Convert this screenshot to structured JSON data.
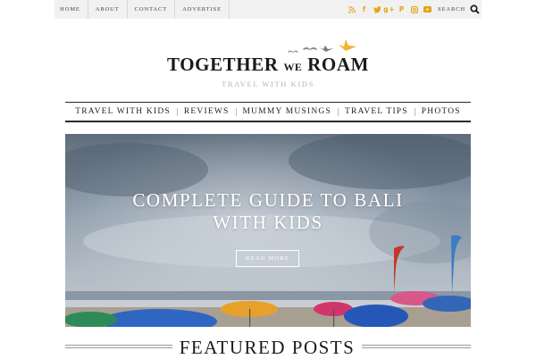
{
  "top_nav": {
    "items": [
      "HOME",
      "ABOUT",
      "CONTACT",
      "ADVERTISE"
    ]
  },
  "social": {
    "icons": [
      "rss-icon",
      "facebook-icon",
      "twitter-icon",
      "google-plus-icon",
      "pinterest-icon",
      "instagram-icon",
      "youtube-icon"
    ],
    "accent_color": "#e3a416"
  },
  "search": {
    "label": "SEARCH"
  },
  "logo": {
    "part1": "TOGETHER",
    "part2": "WE",
    "part3": "ROAM",
    "tagline": "TRAVEL WITH KIDS",
    "bird_color": "#f0b429"
  },
  "main_nav": {
    "items": [
      "TRAVEL WITH KIDS",
      "REVIEWS",
      "MUMMY MUSINGS",
      "TRAVEL TIPS",
      "PHOTOS"
    ]
  },
  "hero": {
    "title_line1": "COMPLETE GUIDE TO BALI",
    "title_line2": "WITH KIDS",
    "button_label": "READ MORE"
  },
  "featured": {
    "title": "FEATURED POSTS"
  }
}
